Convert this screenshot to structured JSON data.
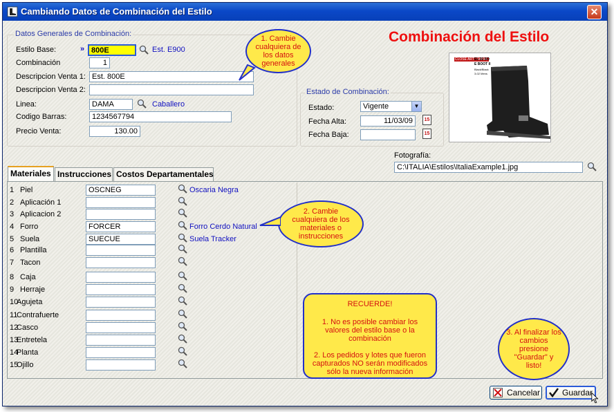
{
  "window": {
    "title": "Cambiando Datos de Combinación del Estilo",
    "close_label": "✕"
  },
  "header": {
    "big_title": "Combinación del Estilo"
  },
  "general": {
    "group_title": "Datos Generales de Combinación:",
    "estilo_base_label": "Estilo Base:",
    "estilo_base_arrow": "»",
    "estilo_base_value": "800E",
    "estilo_base_link": "Est. E900",
    "combinacion_label": "Combinación",
    "combinacion_value": "1",
    "desc1_label": "Descripcion Venta 1:",
    "desc1_value": "Est. 800E",
    "desc2_label": "Descripcion Venta 2:",
    "desc2_value": "",
    "linea_label": "Linea:",
    "linea_value": "DAMA",
    "linea_link": "Caballero",
    "codigo_label": "Codigo Barras:",
    "codigo_value": "1234567794",
    "precio_label": "Precio Venta:",
    "precio_value": "130.00"
  },
  "estado": {
    "group_title": "Estado de Combinación:",
    "estado_label": "Estado:",
    "estado_value": "Vigente",
    "alta_label": "Fecha Alta:",
    "alta_value": "11/03/09",
    "baja_label": "Fecha Baja:",
    "baja_value": "",
    "calendar_label": "15"
  },
  "foto": {
    "label": "Fotografía:",
    "path": "C:\\ITALIA\\Estilos\\ItaliaExample1.jpg"
  },
  "tabs": [
    {
      "label": "Materiales"
    },
    {
      "label": "Instrucciones"
    },
    {
      "label": "Costos Departamentales"
    }
  ],
  "materiales": [
    {
      "num": "1",
      "name": "Piel",
      "code": "OSCNEG",
      "desc": "Oscaria Negra"
    },
    {
      "num": "2",
      "name": "Aplicación 1",
      "code": "",
      "desc": ""
    },
    {
      "num": "3",
      "name": "Aplicacion 2",
      "code": "",
      "desc": ""
    },
    {
      "num": "4",
      "name": "Forro",
      "code": "FORCER",
      "desc": "Forro Cerdo Natural"
    },
    {
      "num": "5",
      "name": "Suela",
      "code": "SUECUE",
      "desc": "Suela Tracker"
    },
    {
      "num": "6",
      "name": "Plantilla",
      "code": "",
      "desc": ""
    },
    {
      "num": "7",
      "name": "Tacon",
      "code": "",
      "desc": ""
    },
    {
      "num": "8",
      "name": "Caja",
      "code": "",
      "desc": ""
    },
    {
      "num": "9",
      "name": "Herraje",
      "code": "",
      "desc": ""
    },
    {
      "num": "10",
      "name": "Agujeta",
      "code": "",
      "desc": ""
    },
    {
      "num": "11",
      "name": "Contrafuerte",
      "code": "",
      "desc": ""
    },
    {
      "num": "12",
      "name": "Casco",
      "code": "",
      "desc": ""
    },
    {
      "num": "13",
      "name": "Entretela",
      "code": "",
      "desc": ""
    },
    {
      "num": "14",
      "name": "Planta",
      "code": "",
      "desc": ""
    },
    {
      "num": "15",
      "name": "Ojillo",
      "code": "",
      "desc": ""
    }
  ],
  "callouts": {
    "c1": "1. Cambie cualquiera de los datos generales",
    "c2": "2. Cambie cualquiera de los materiales o instrucciones",
    "c3": "3. Al finalizar los cambios presione \"Guardar\" y listo!",
    "recuerde_title": "RECUERDE!",
    "recuerde_1": "1. No es posible cambiar los valores del estilo base o la combinación",
    "recuerde_2": "2. Los pedidos y lotes que fueron capturados NO serán modificados sólo la nueva información"
  },
  "buttons": {
    "cancel_label": "Cancelar",
    "save_label": "Guardar"
  },
  "photo_caption": {
    "brand": "CLOSE ARTESANAL",
    "code": "EL 31 SO",
    "model": "E BOOT II",
    "desc1": "Black/Black",
    "desc2": "3-02 Mens"
  },
  "colors": {
    "title_red": "#ee1010",
    "balloon_yellow": "#ffe94a",
    "balloon_border": "#2230c8",
    "link_blue": "#1010c0"
  }
}
